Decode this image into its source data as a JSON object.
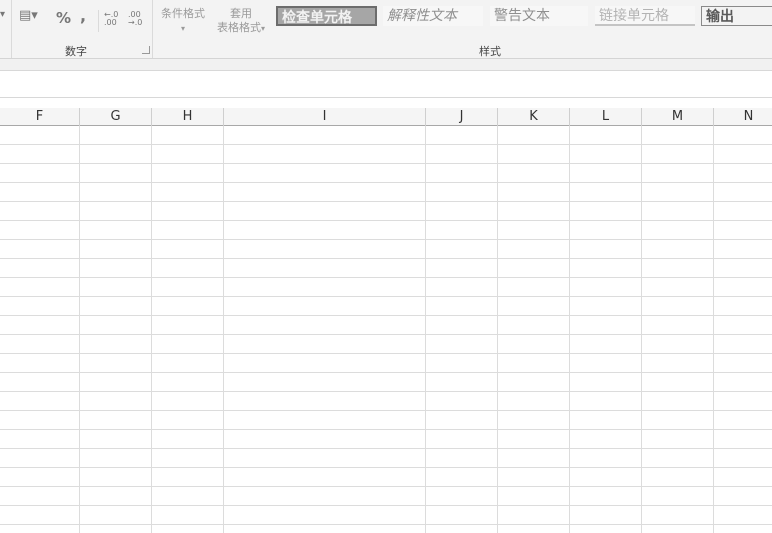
{
  "ribbon": {
    "number_group_label": "数字",
    "styles_group_label": "样式",
    "number_buttons": {
      "percent": "%",
      "comma": ",",
      "increase_decimal": "←.0 .00",
      "decrease_decimal": ".00 →.0"
    },
    "conditional_format_label": "条件格式",
    "table_format_label_1": "套用",
    "table_format_label_2": "表格格式",
    "cell_styles": [
      "检查单元格",
      "解释性文本",
      "警告文本",
      "链接单元格",
      "输出"
    ]
  },
  "sheet": {
    "columns": [
      "F",
      "G",
      "H",
      "I",
      "J",
      "K",
      "L",
      "M",
      "N"
    ]
  }
}
